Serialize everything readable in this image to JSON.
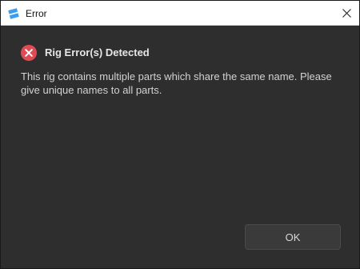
{
  "window": {
    "title": "Error",
    "app_icon": "roblox-studio-icon",
    "close_icon": "close-icon"
  },
  "dialog": {
    "status_icon": "error-icon",
    "heading": "Rig Error(s) Detected",
    "message": "This rig contains multiple parts which share the same name. Please give unique names to all parts.",
    "ok_label": "OK"
  },
  "colors": {
    "titlebar_bg": "#ffffff",
    "content_bg": "#2e2e2e",
    "error_red": "#e04a55",
    "app_icon_blue": "#3b9cf0",
    "button_bg": "#3a3a3a"
  }
}
